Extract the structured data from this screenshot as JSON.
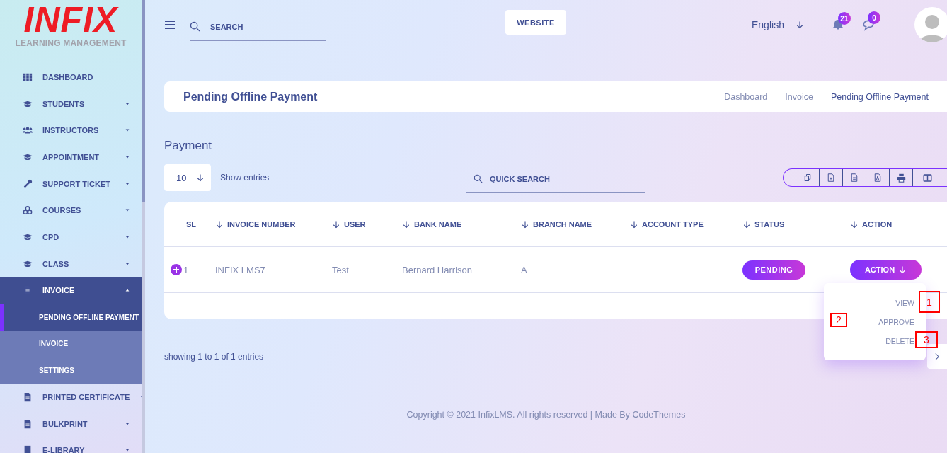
{
  "logo": {
    "title": "INFIX",
    "subtitle": "LEARNING MANAGEMENT"
  },
  "sidebar": {
    "items": [
      {
        "label": "DASHBOARD",
        "kind": "grid",
        "selected": false
      },
      {
        "label": "STUDENTS",
        "kind": "cap",
        "expanded": false,
        "selected": false
      },
      {
        "label": "INSTRUCTORS",
        "kind": "users",
        "expanded": false,
        "selected": false
      },
      {
        "label": "APPOINTMENT",
        "kind": "cap",
        "expanded": false,
        "selected": false
      },
      {
        "label": "SUPPORT TICKET",
        "kind": "wrench",
        "expanded": false,
        "selected": false
      },
      {
        "label": "COURSES",
        "kind": "cubes",
        "expanded": false,
        "selected": false
      },
      {
        "label": "CPD",
        "kind": "cap",
        "expanded": false,
        "selected": false
      },
      {
        "label": "CLASS",
        "kind": "cap",
        "expanded": false,
        "selected": false
      },
      {
        "label": "INVOICE",
        "kind": "doc",
        "expanded": true,
        "selected": true,
        "children": [
          {
            "label": "PENDING OFFLINE PAYMENT",
            "selected": true
          },
          {
            "label": "INVOICE",
            "selected": false
          },
          {
            "label": "SETTINGS",
            "selected": false
          }
        ]
      },
      {
        "label": "PRINTED CERTIFICATE",
        "kind": "doc",
        "expanded": false,
        "selected": false
      },
      {
        "label": "BULKPRINT",
        "kind": "doc",
        "expanded": false,
        "selected": false
      },
      {
        "label": "E-LIBRARY",
        "kind": "book",
        "expanded": false,
        "selected": false
      }
    ]
  },
  "topbar": {
    "search": {
      "placeholder": "SEARCH"
    },
    "website_button": "WEBSITE",
    "language": "English",
    "notifications_badge": "21",
    "messages_badge": "0"
  },
  "page_header": {
    "title": "Pending Offline Payment",
    "breadcrumbs": [
      "Dashboard",
      "Invoice",
      "Pending Offline Payment"
    ]
  },
  "payment": {
    "title": "Payment",
    "page_length": "10",
    "show_entries": "Show entries",
    "quick_search": {
      "placeholder": "QUICK SEARCH"
    },
    "table": {
      "columns": [
        {
          "label": "SL",
          "sortable": false
        },
        {
          "label": "INVOICE NUMBER",
          "sortable": true
        },
        {
          "label": "USER",
          "sortable": true
        },
        {
          "label": "BANK NAME",
          "sortable": true
        },
        {
          "label": "BRANCH NAME",
          "sortable": true
        },
        {
          "label": "ACCOUNT TYPE",
          "sortable": true
        },
        {
          "label": "STATUS",
          "sortable": true
        },
        {
          "label": "ACTION",
          "sortable": true
        }
      ],
      "rows": [
        {
          "sl": "1",
          "invoice_number": "INFIX LMS7",
          "user": "Test",
          "bank_name": "Bernard Harrison",
          "branch_name": "A",
          "status": "PENDING",
          "action": "ACTION",
          "menu_open": true,
          "menu": [
            "VIEW",
            "APPROVE",
            "DELETE"
          ]
        }
      ]
    },
    "info": "showing 1 to 1 of 1 entries"
  },
  "annotations": [
    {
      "label": "1"
    },
    {
      "label": "2"
    },
    {
      "label": "3"
    }
  ],
  "footer": "Copyright © 2021 InfixLMS. All rights reserved | Made By CodeThemes"
}
